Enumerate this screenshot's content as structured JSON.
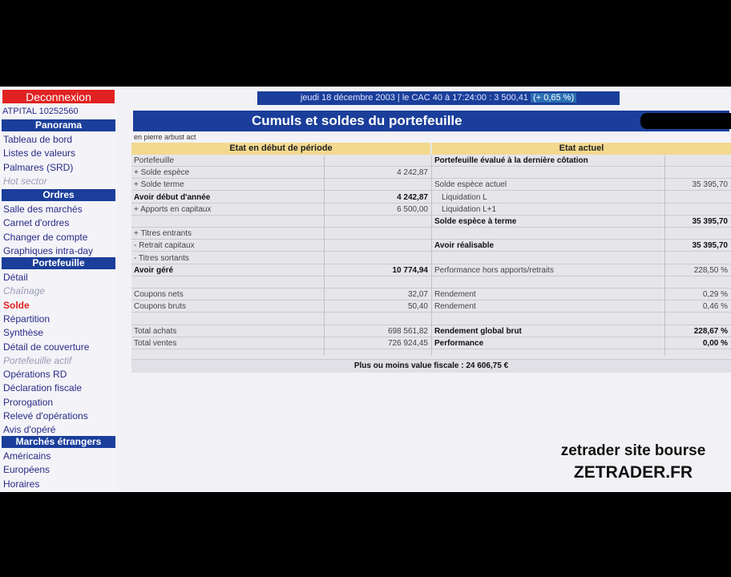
{
  "sidebar": {
    "logout_label": "Deconnexion",
    "account": "ATPITAL 10252560",
    "sections": [
      {
        "title": "Panorama",
        "items": [
          {
            "label": "Tableau de bord"
          },
          {
            "label": "Listes de valeurs"
          },
          {
            "label": "Palmares (SRD)"
          },
          {
            "label": "Hot sector",
            "faded": true
          }
        ]
      },
      {
        "title": "Ordres",
        "items": [
          {
            "label": "Salle des marchés"
          },
          {
            "label": "Carnet d'ordres"
          },
          {
            "label": "Changer de compte"
          },
          {
            "label": "Graphiques intra-day"
          }
        ]
      },
      {
        "title": "Portefeuille",
        "items": [
          {
            "label": "Détail"
          },
          {
            "label": "Chaînage",
            "faded": true
          },
          {
            "label": "Solde",
            "active": true
          },
          {
            "label": "Répartition"
          },
          {
            "label": "Synthèse"
          },
          {
            "label": "Détail de couverture"
          },
          {
            "label": "Portefeuille actif",
            "faded": true
          },
          {
            "label": "Opérations RD"
          },
          {
            "label": "Déclaration fiscale"
          },
          {
            "label": "Prorogation"
          },
          {
            "label": "Relevé d'opérations"
          },
          {
            "label": "Avis d'opéré"
          }
        ]
      },
      {
        "title": "Marchés étrangers",
        "items": [
          {
            "label": "Américains"
          },
          {
            "label": "Européens"
          },
          {
            "label": "Horaires"
          }
        ]
      }
    ]
  },
  "topbar": {
    "date_text": "jeudi 18 décembre 2003 | le CAC 40 à 17:24:00 : 3 500,41",
    "change_text": "(+ 0,65 %)"
  },
  "page": {
    "title": "Cumuls et soldes du portefeuille",
    "sublabel": "en pierre arbust act"
  },
  "table": {
    "left_header": "Etat en début de période",
    "right_header": "Etat actuel",
    "left_rows": [
      {
        "label": "Portefeuille",
        "value": "",
        "bold": false
      },
      {
        "label": "+ Solde espèce",
        "value": "4 242,87",
        "bold": false
      },
      {
        "label": "+ Solde terme",
        "value": "",
        "bold": false
      },
      {
        "label": "Avoir début d'année",
        "value": "4 242,87",
        "bold": true
      },
      {
        "label": "+ Apports en capitaux",
        "value": "6 500,00",
        "bold": false
      },
      {
        "label": "",
        "value": "",
        "bold": false
      },
      {
        "label": "+ Titres entrants",
        "value": "",
        "bold": false
      },
      {
        "label": "- Retrait capitaux",
        "value": "",
        "bold": false
      },
      {
        "label": "- Titres sortants",
        "value": "",
        "bold": false
      },
      {
        "label": "Avoir géré",
        "value": "10 774,94",
        "bold": true
      },
      {
        "label": "",
        "value": "",
        "bold": false
      },
      {
        "label": "Coupons nets",
        "value": "32,07",
        "bold": false
      },
      {
        "label": "Coupons bruts",
        "value": "50,40",
        "bold": false
      },
      {
        "label": "",
        "value": "",
        "bold": false
      },
      {
        "label": "Total achats",
        "value": "698 561,82",
        "bold": false
      },
      {
        "label": "Total ventes",
        "value": "726 924,45",
        "bold": false
      }
    ],
    "right_rows": [
      {
        "label": "Portefeuille évalué à la dernière côtation",
        "value": "",
        "bold": true
      },
      {
        "label": "",
        "value": "",
        "bold": false
      },
      {
        "label": "Solde espèce actuel",
        "value": "35 395,70",
        "bold": false
      },
      {
        "label": "Liquidation L",
        "value": "",
        "bold": false
      },
      {
        "label": "Liquidation L+1",
        "value": "",
        "bold": false
      },
      {
        "label": "Solde espèce à terme",
        "value": "35 395,70",
        "bold": true
      },
      {
        "label": "",
        "value": "",
        "bold": false
      },
      {
        "label": "Avoir réalisable",
        "value": "35 395,70",
        "bold": true
      },
      {
        "label": "",
        "value": "",
        "bold": false
      },
      {
        "label": "Performance hors apports/retraits",
        "value": "228,50 %",
        "bold": false
      },
      {
        "label": "",
        "value": "",
        "bold": false
      },
      {
        "label": "Rendement",
        "value": "0,29 %",
        "bold": false
      },
      {
        "label": "Rendement",
        "value": "0,46 %",
        "bold": false
      },
      {
        "label": "",
        "value": "",
        "bold": false
      },
      {
        "label": "Rendement global brut",
        "value": "228,67 %",
        "bold": true
      },
      {
        "label": "Performance",
        "value": "0,00 %",
        "bold": true
      }
    ],
    "footer": "Plus ou moins value fiscale : 24 606,75 €"
  },
  "watermark": {
    "line1": "zetrader site bourse",
    "line2": "ZETRADER.FR"
  }
}
